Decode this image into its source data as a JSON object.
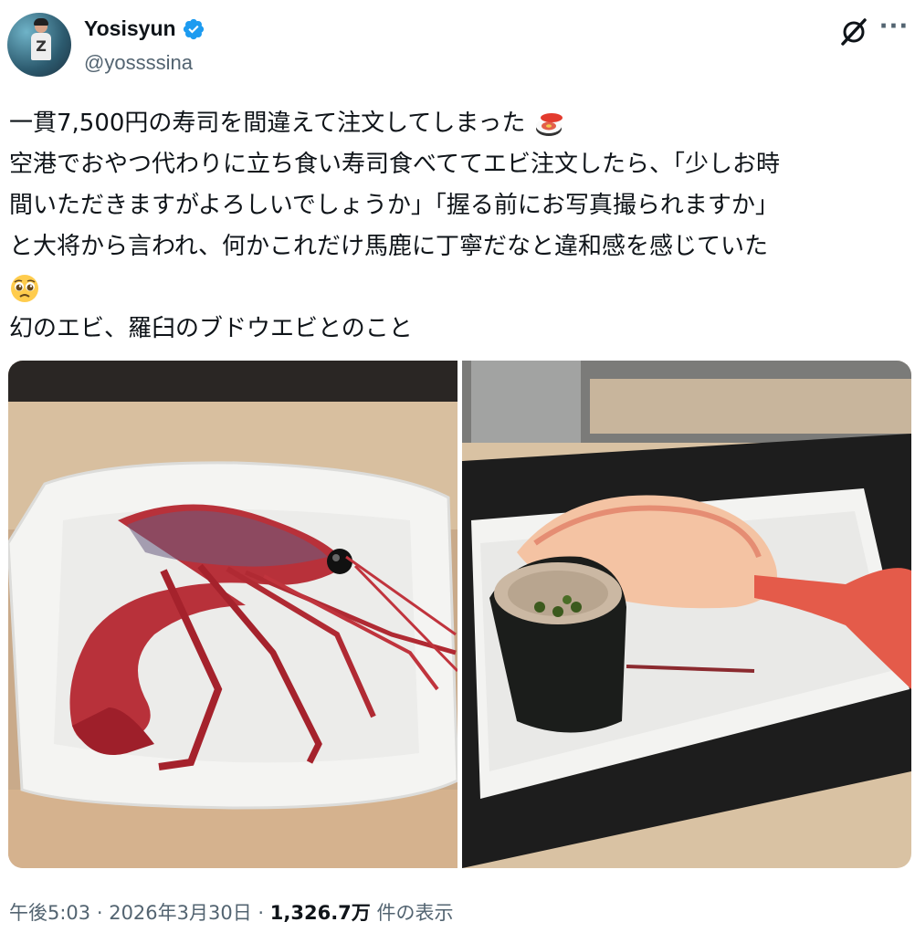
{
  "author": {
    "display_name": "Yosisyun",
    "handle": "@yossssina",
    "verified": true
  },
  "icons": {
    "verified": "verified-badge-icon",
    "grok": "grok-icon",
    "more": "more-options-icon"
  },
  "colors": {
    "verified_blue": "#1d9bf0",
    "text_primary": "#0f1419",
    "text_secondary": "#536471"
  },
  "tweet": {
    "lines": [
      "一貫7,500円の寿司を間違えて注文してしまった",
      "空港でおやつ代わりに立ち食い寿司食べててエビ注文したら、「少しお時",
      "間いただきますがよろしいでしょうか」「握る前にお写真撮られますか」",
      "と大将から言われ、何かこれだけ馬鹿に丁寧だなと違和感を感じていた",
      "",
      "幻のエビ、羅臼のブドウエビとのこと"
    ],
    "emojis": [
      "sushi-emoji",
      "pleading-face-emoji"
    ]
  },
  "media": [
    {
      "name": "photo-raw-shrimp"
    },
    {
      "name": "photo-shrimp-nigiri"
    }
  ],
  "meta": {
    "time": "午後5:03",
    "sep1": " · ",
    "date": "2026年3月30日",
    "sep2": " · ",
    "views": "1,326.7万",
    "views_label": " 件の表示"
  }
}
